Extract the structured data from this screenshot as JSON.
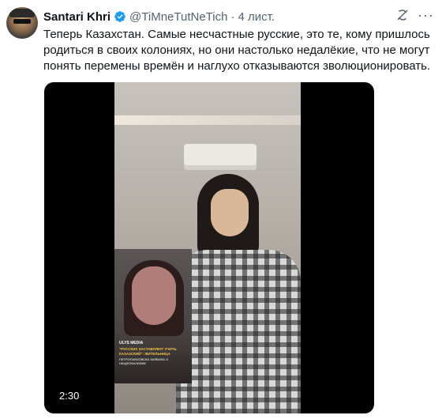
{
  "tweet": {
    "author_name": "Santari Khri",
    "handle": "@TiMneTutNeTich",
    "separator": "·",
    "date": "4 лист.",
    "verified": true,
    "text": "Теперь Казахстан. Самые несчастные русские, это те, кому пришлось родиться в своих колониях, но они настолько недалёкие, что не могут понять перемены времён и наглухо отказываются зволюционировать."
  },
  "icons": {
    "verified": "verified-badge-icon",
    "grok": "grok-icon",
    "more": "more-icon"
  },
  "media": {
    "duration": "2:30",
    "inset": {
      "brand": "ULYS MEDIA",
      "headline": "\"РУССКИХ ЗАСТАВЛЯЮТ УЧИТЬ КАЗАХСКИЙ\": ЖИТЕЛЬНИЦА",
      "subline": "ПЕТРОПАВЛОВСКА ЗАЯВИЛА О НАЦИОНАЛИЗМЕ"
    }
  },
  "colors": {
    "verified_blue": "#1d9bf0",
    "secondary_text": "#536471",
    "primary_text": "#0f1419",
    "inset_headline": "#f4c542"
  }
}
